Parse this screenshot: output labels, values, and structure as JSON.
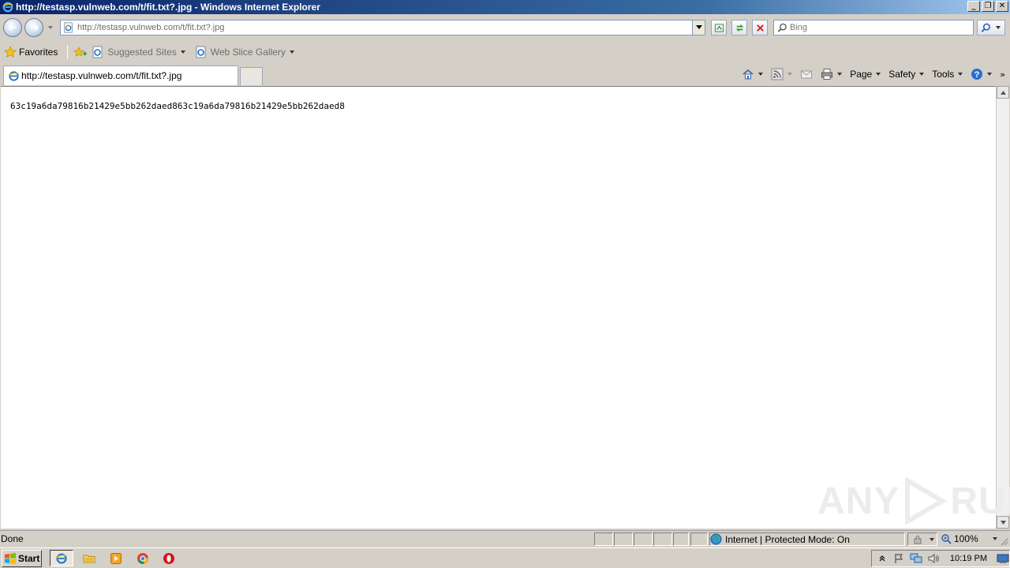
{
  "window": {
    "title": "http://testasp.vulnweb.com/t/fit.txt?.jpg - Windows Internet Explorer"
  },
  "address_bar": {
    "url": "http://testasp.vulnweb.com/t/fit.txt?.jpg"
  },
  "search": {
    "placeholder": "Bing"
  },
  "favorites_bar": {
    "favorites_label": "Favorites",
    "suggested_sites_label": "Suggested Sites",
    "web_slice_gallery_label": "Web Slice Gallery"
  },
  "tab": {
    "title": "http://testasp.vulnweb.com/t/fit.txt?.jpg"
  },
  "command_bar": {
    "page_label": "Page",
    "safety_label": "Safety",
    "tools_label": "Tools"
  },
  "content": {
    "text": "63c19a6da79816b21429e5bb262daed863c19a6da79816b21429e5bb262daed8"
  },
  "watermark": {
    "left": "ANY",
    "right": "RUN"
  },
  "status_bar": {
    "status_text": "Done",
    "zone_text": "Internet | Protected Mode: On",
    "zoom_level": "100%"
  },
  "taskbar": {
    "start_label": "Start",
    "clock": "10:19 PM"
  },
  "colors": {
    "titlebar_start": "#0a246a",
    "titlebar_end": "#a6caf0",
    "chrome": "#d4d0c8"
  },
  "icons": [
    "ie-logo-icon",
    "back-arrow-icon",
    "forward-arrow-icon",
    "compatibility-view-icon",
    "refresh-icon",
    "stop-icon",
    "search-icon",
    "favorites-star-icon",
    "add-favorites-icon",
    "home-icon",
    "rss-feed-icon",
    "read-mail-icon",
    "print-icon",
    "help-icon",
    "globe-icon",
    "zoom-icon",
    "windows-flag-icon",
    "explorer-folder-icon",
    "media-player-icon",
    "chrome-icon",
    "opera-icon"
  ]
}
